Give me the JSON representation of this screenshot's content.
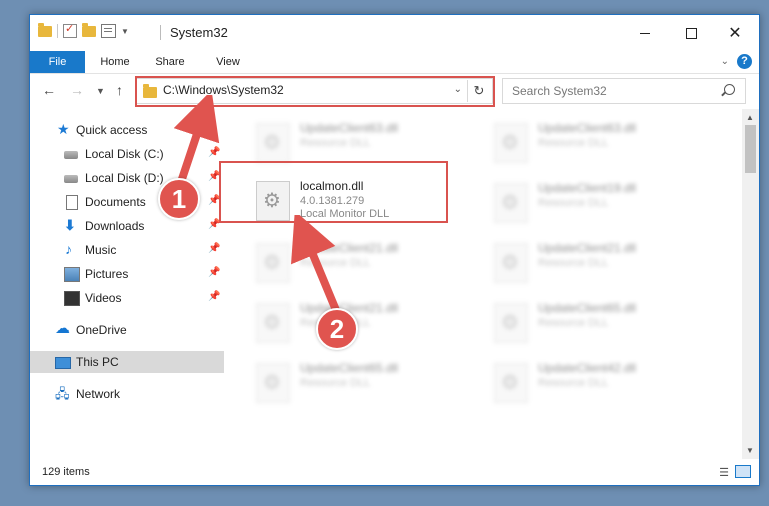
{
  "window": {
    "title": "System32",
    "controls": {
      "minimize": "",
      "maximize": "",
      "close": "✕"
    }
  },
  "ribbon": {
    "tabs": [
      {
        "label": "File",
        "active": true
      },
      {
        "label": "Home"
      },
      {
        "label": "Share"
      },
      {
        "label": "View"
      }
    ],
    "help": "?"
  },
  "nav": {
    "address": "C:\\Windows\\System32",
    "search_placeholder": "Search System32"
  },
  "sidebar": {
    "items": [
      {
        "label": "Quick access",
        "icon": "star-icon"
      },
      {
        "label": "Local Disk (C:)",
        "icon": "disk-icon",
        "pinned": true
      },
      {
        "label": "Local Disk (D:)",
        "icon": "disk-icon",
        "pinned": true
      },
      {
        "label": "Documents",
        "icon": "documents-icon",
        "pinned": true
      },
      {
        "label": "Downloads",
        "icon": "download-icon",
        "pinned": true
      },
      {
        "label": "Music",
        "icon": "music-icon",
        "pinned": true
      },
      {
        "label": "Pictures",
        "icon": "pictures-icon",
        "pinned": true
      },
      {
        "label": "Videos",
        "icon": "videos-icon",
        "pinned": true
      },
      {
        "label": "OneDrive",
        "icon": "cloud-icon"
      },
      {
        "label": "This PC",
        "icon": "pc-icon",
        "selected": true
      },
      {
        "label": "Network",
        "icon": "network-icon"
      }
    ]
  },
  "files": {
    "left": [
      {
        "name": "UpdateClient63.dll",
        "desc": "Resource DLL"
      },
      {
        "name": "localmon.dll",
        "version": "4.0.1381.279",
        "desc": "Local Monitor DLL",
        "highlighted": true
      },
      {
        "name": "UpdateClient21.dll",
        "desc": "Resource DLL"
      },
      {
        "name": "UpdateClient21.dll",
        "desc": "Resource DLL"
      },
      {
        "name": "UpdateClient65.dll",
        "desc": "Resource DLL"
      }
    ],
    "right": [
      {
        "name": "UpdateClient63.dll",
        "desc": "Resource DLL"
      },
      {
        "name": "UpdateClient19.dll",
        "desc": "Resource DLL"
      },
      {
        "name": "UpdateClient21.dll",
        "desc": "Resource DLL"
      },
      {
        "name": "UpdateClient65.dll",
        "desc": "Resource DLL"
      },
      {
        "name": "UpdateClient42.dll",
        "desc": "Resource DLL"
      }
    ]
  },
  "status": {
    "item_count": "129 items"
  },
  "annotations": {
    "step1": "1",
    "step2": "2",
    "color": "#e0544f"
  }
}
